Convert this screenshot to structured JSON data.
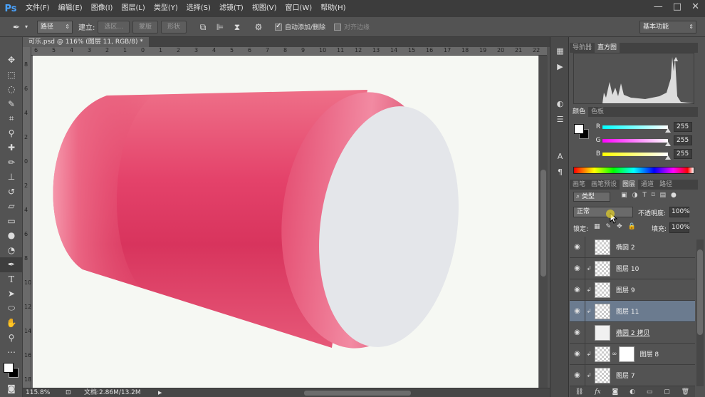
{
  "app": {
    "logo": "Ps"
  },
  "menu": [
    "文件(F)",
    "编辑(E)",
    "图像(I)",
    "图层(L)",
    "类型(Y)",
    "选择(S)",
    "滤镜(T)",
    "视图(V)",
    "窗口(W)",
    "帮助(H)"
  ],
  "window_controls": [
    "—",
    "□",
    "✕"
  ],
  "options": {
    "mode": "路径",
    "build_label": "建立:",
    "selection_btn": "选区...",
    "mask_btn": "蒙版",
    "shape_btn": "形状",
    "auto_add_label": "自动添加/删除",
    "auto_add_checked": true,
    "align_edges_label": "对齐边缘",
    "align_edges_checked": false,
    "workspace": "基本功能"
  },
  "document": {
    "tab_title": "可乐.psd @ 116% (图层 11, RGB/8) *",
    "zoom": "115.8%",
    "doc_info": "文档:2.86M/13.2M"
  },
  "ruler_top": [
    "6",
    "5",
    "4",
    "3",
    "2",
    "1",
    "0",
    "1",
    "2",
    "3",
    "4",
    "5",
    "6",
    "7",
    "8",
    "9",
    "10",
    "11",
    "12",
    "13",
    "14",
    "15",
    "16",
    "17",
    "18",
    "19",
    "20",
    "21",
    "22"
  ],
  "ruler_left": [
    "8",
    "6",
    "4",
    "2",
    "0",
    "2",
    "4",
    "6",
    "8",
    "10",
    "12",
    "14",
    "16",
    "18"
  ],
  "panels": {
    "top_tabs": [
      "导航器",
      "直方图"
    ],
    "color_tabs": [
      "颜色",
      "色板"
    ],
    "color_channels": [
      {
        "label": "R",
        "value": "255"
      },
      {
        "label": "G",
        "value": "255"
      },
      {
        "label": "B",
        "value": "255"
      }
    ],
    "layer_tabs": [
      "画笔",
      "画笔预设",
      "图层",
      "通道",
      "路径"
    ],
    "filter_kind": "类型",
    "blend_mode": "正常",
    "opacity_label": "不透明度:",
    "opacity": "100%",
    "lock_label": "锁定:",
    "fill_label": "填充:",
    "fill": "100%"
  },
  "layers": [
    {
      "name": "椭圆 2",
      "clip": false,
      "selected": false
    },
    {
      "name": "图层 10",
      "clip": true,
      "selected": false
    },
    {
      "name": "图层 9",
      "clip": true,
      "selected": false
    },
    {
      "name": "图层 11",
      "clip": true,
      "selected": true
    },
    {
      "name": "椭圆 2 拷贝",
      "clip": false,
      "selected": false
    },
    {
      "name": "图层 8",
      "clip": true,
      "selected": false
    },
    {
      "name": "图层 7",
      "clip": true,
      "selected": false
    }
  ],
  "colors": {
    "cup_main": "#e14a6c",
    "cup_rim": "#d63d5f",
    "ellipse": "#e4e6ea",
    "selected_layer": "#6b7b8f",
    "accent": "#4aa3ff"
  }
}
